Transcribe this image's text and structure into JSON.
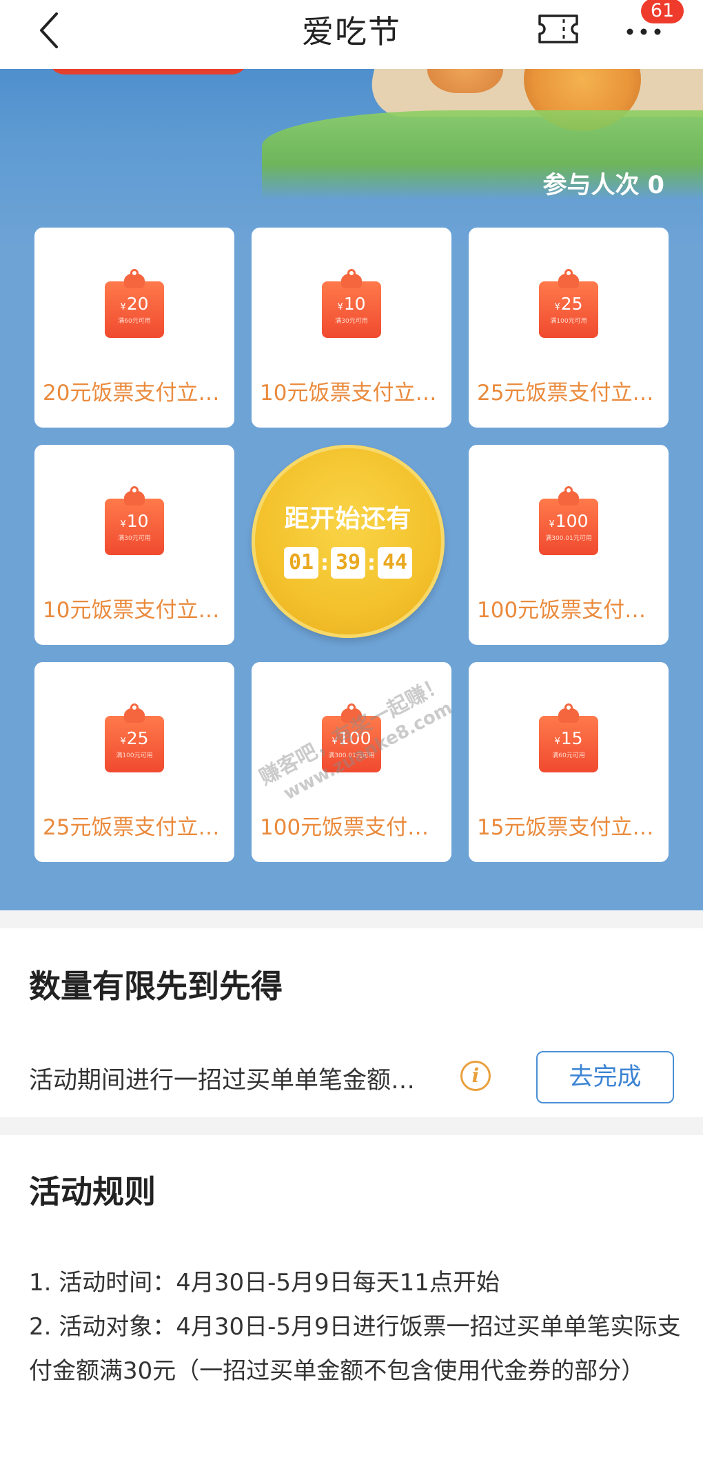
{
  "nav": {
    "title": "爱吃节",
    "badge": "61",
    "icons": [
      "back-icon",
      "ticket-icon",
      "more-icon"
    ]
  },
  "hero": {
    "participants_label": "参与人次",
    "participants_count": "0",
    "coupons": [
      {
        "amount": "20",
        "currency": "¥",
        "sub": "满60元可用",
        "label": "20元饭票支付立…"
      },
      {
        "amount": "10",
        "currency": "¥",
        "sub": "满30元可用",
        "label": "10元饭票支付立…"
      },
      {
        "amount": "25",
        "currency": "¥",
        "sub": "满100元可用",
        "label": "25元饭票支付立…"
      },
      {
        "amount": "10",
        "currency": "¥",
        "sub": "满30元可用",
        "label": "10元饭票支付立…"
      },
      {
        "amount": "100",
        "currency": "¥",
        "sub": "满300.01元可用",
        "label": "100元饭票支付…"
      },
      {
        "amount": "25",
        "currency": "¥",
        "sub": "满100元可用",
        "label": "25元饭票支付立…"
      },
      {
        "amount": "100",
        "currency": "¥",
        "sub": "满300.01元可用",
        "label": "100元饭票支付…"
      },
      {
        "amount": "15",
        "currency": "¥",
        "sub": "满60元可用",
        "label": "15元饭票支付立…"
      }
    ],
    "countdown": {
      "title": "距开始还有",
      "hours": "01",
      "minutes": "39",
      "seconds": "44"
    },
    "watermark_line1": "赚客吧，有奖一起赚！",
    "watermark_line2": "www.zuanke8.com"
  },
  "task": {
    "title": "数量有限先到先得",
    "text": "活动期间进行一招过买单单笔金额…",
    "info_icon": "i",
    "button": "去完成"
  },
  "rules": {
    "title": "活动规则",
    "items": [
      "1. 活动时间：4月30日-5月9日每天11点开始",
      "2. 活动对象：4月30日-5月9日进行饭票一招过买单单笔实际支付金额满30元（一招过买单金额不包含使用代金券的部分）"
    ]
  },
  "colors": {
    "hero_blue": "#6ea3d6",
    "coupon_text": "#ea8a3c",
    "coupon_tag": "#f04a2f",
    "countdown_gold": "#f3c12b",
    "button_blue": "#3c84d4",
    "badge_red": "#ee3b2b"
  }
}
